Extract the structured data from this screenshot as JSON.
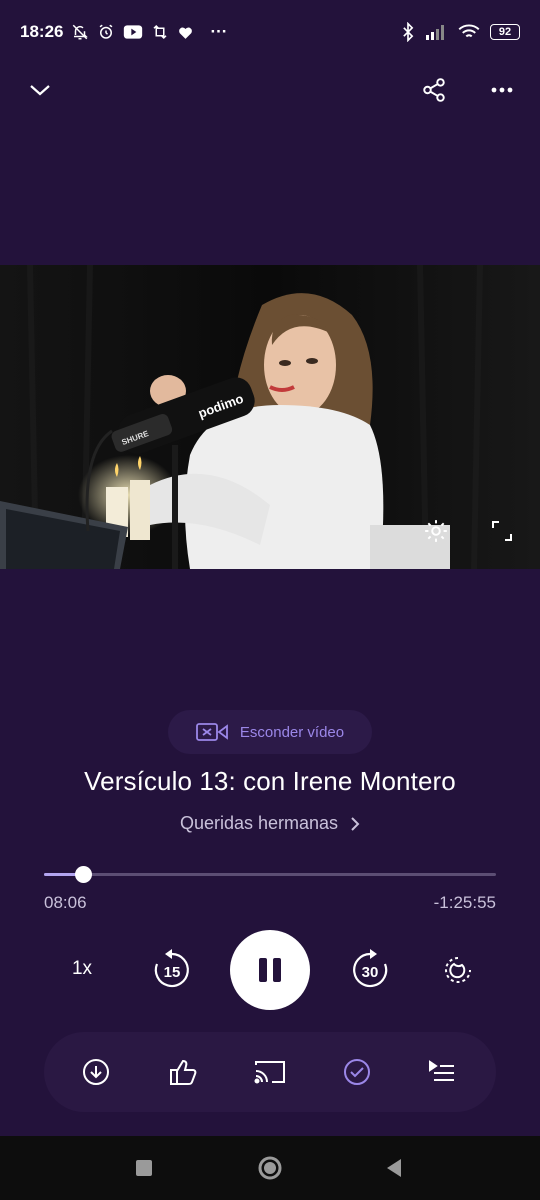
{
  "status_bar": {
    "time": "18:26",
    "battery": "92",
    "more": "···"
  },
  "video": {
    "mic_brand": "podimo",
    "mic_maker": "SHURE"
  },
  "hide_video": {
    "label": "Esconder vídeo"
  },
  "episode": {
    "title": "Versículo 13: con Irene Montero",
    "show": "Queridas hermanas"
  },
  "progress": {
    "elapsed": "08:06",
    "remaining": "-1:25:55",
    "fraction": 0.087
  },
  "controls": {
    "speed": "1x",
    "rewind_seconds": "15",
    "forward_seconds": "30"
  },
  "colors": {
    "background": "#23123b",
    "accent": "#9b87e8",
    "toolbar": "#2a1843"
  }
}
